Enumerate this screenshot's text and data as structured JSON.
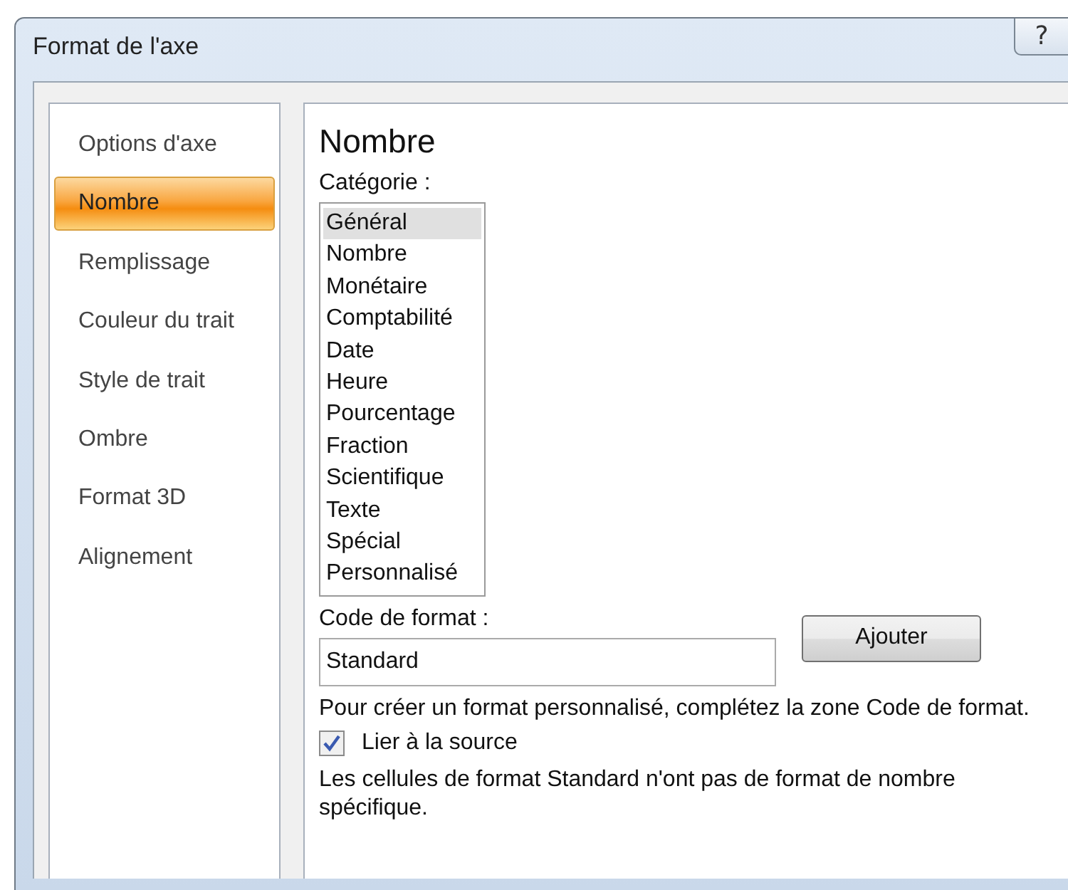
{
  "window": {
    "title": "Format de l'axe",
    "help_button": "?"
  },
  "sidebar": {
    "items": [
      {
        "label": "Options d'axe",
        "selected": false
      },
      {
        "label": "Nombre",
        "selected": true
      },
      {
        "label": "Remplissage",
        "selected": false
      },
      {
        "label": "Couleur du trait",
        "selected": false
      },
      {
        "label": "Style de trait",
        "selected": false
      },
      {
        "label": "Ombre",
        "selected": false
      },
      {
        "label": "Format 3D",
        "selected": false
      },
      {
        "label": "Alignement",
        "selected": false
      }
    ]
  },
  "pane": {
    "heading": "Nombre",
    "category_label": "Catégorie :",
    "categories": [
      {
        "label": "Général",
        "selected": true
      },
      {
        "label": "Nombre",
        "selected": false
      },
      {
        "label": "Monétaire",
        "selected": false
      },
      {
        "label": "Comptabilité",
        "selected": false
      },
      {
        "label": "Date",
        "selected": false
      },
      {
        "label": "Heure",
        "selected": false
      },
      {
        "label": "Pourcentage",
        "selected": false
      },
      {
        "label": "Fraction",
        "selected": false
      },
      {
        "label": "Scientifique",
        "selected": false
      },
      {
        "label": "Texte",
        "selected": false
      },
      {
        "label": "Spécial",
        "selected": false
      },
      {
        "label": "Personnalisé",
        "selected": false
      }
    ],
    "format_code_label": "Code de format :",
    "format_code": "Standard",
    "add_button": "Ajouter",
    "hint": "Pour créer un format personnalisé, complétez la zone Code de format.",
    "link_to_source": {
      "label": "Lier à la source",
      "checked": true
    },
    "note": "Les cellules de format Standard n'ont pas de format de nombre spécifique."
  }
}
